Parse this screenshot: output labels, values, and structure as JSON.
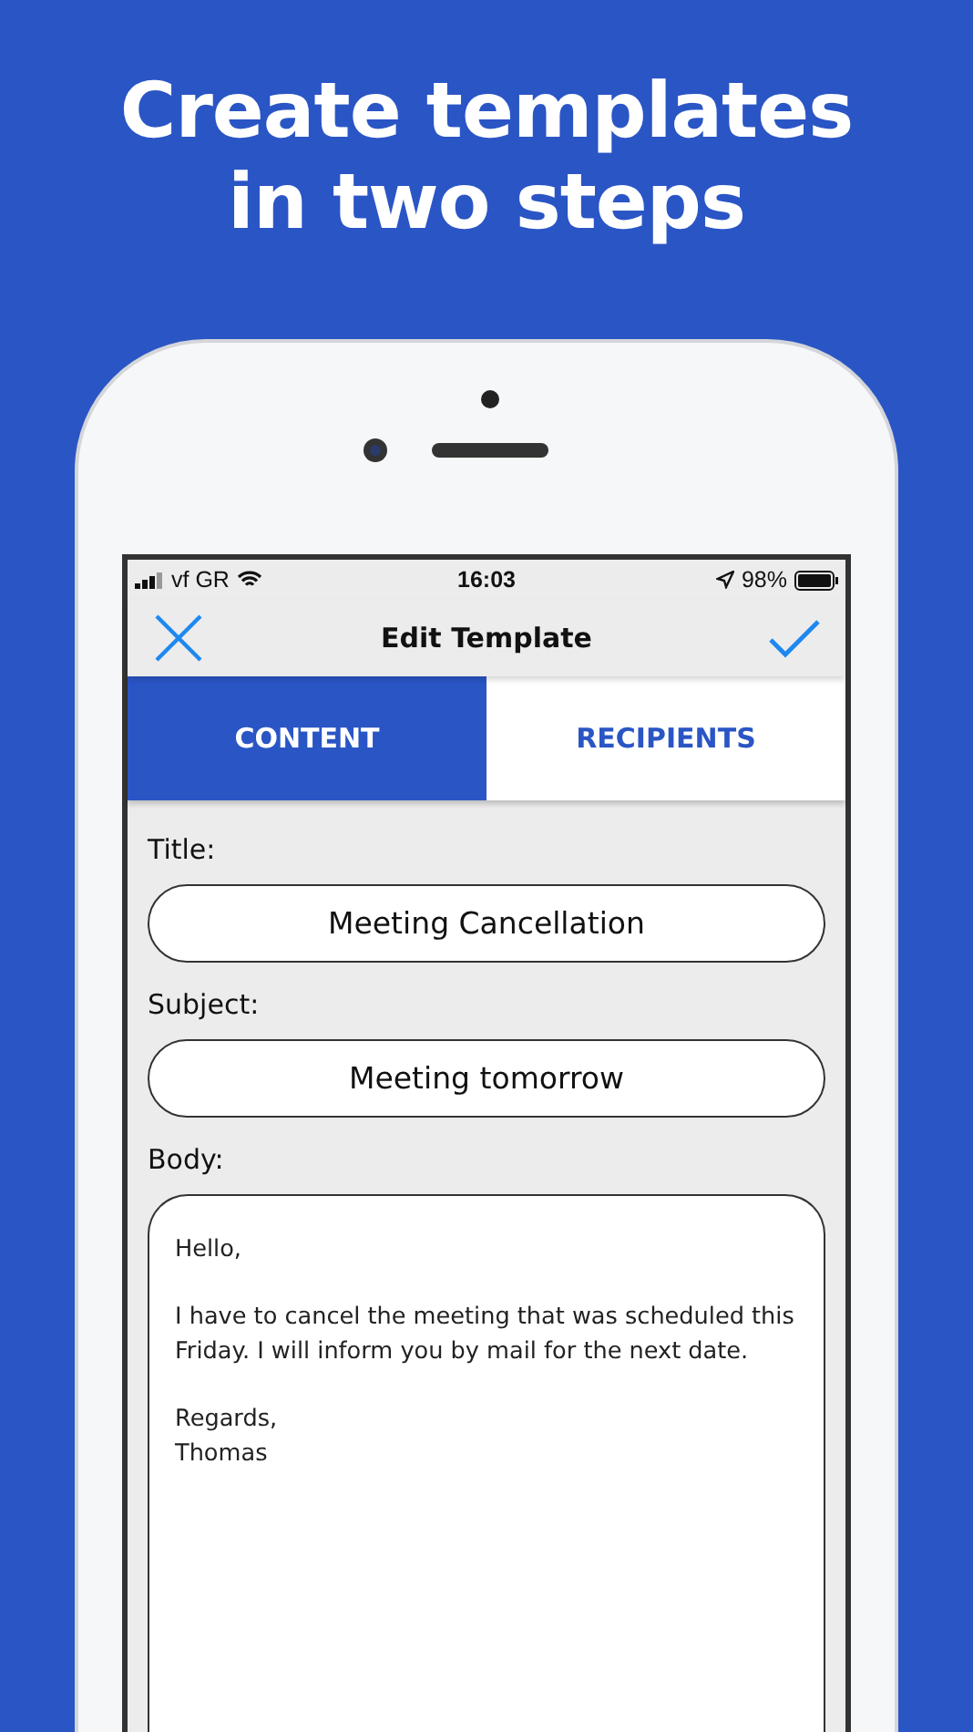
{
  "headline": [
    "Create templates",
    "in two steps"
  ],
  "status_bar": {
    "carrier": "vf GR",
    "time": "16:03",
    "battery": "98%"
  },
  "nav": {
    "title": "Edit Template"
  },
  "tabs": [
    {
      "label": "CONTENT",
      "selected": true
    },
    {
      "label": "RECIPIENTS",
      "selected": false
    }
  ],
  "form": {
    "fields": [
      {
        "label": "Title:",
        "value": "Meeting Cancellation"
      },
      {
        "label": "Subject:",
        "value": "Meeting tomorrow"
      }
    ],
    "body": {
      "label": "Body:",
      "paragraphs": [
        "Hello,",
        "I have to cancel the meeting that was scheduled this Friday. I will inform you by mail for the next date.",
        "Regards,\nThomas"
      ]
    }
  }
}
